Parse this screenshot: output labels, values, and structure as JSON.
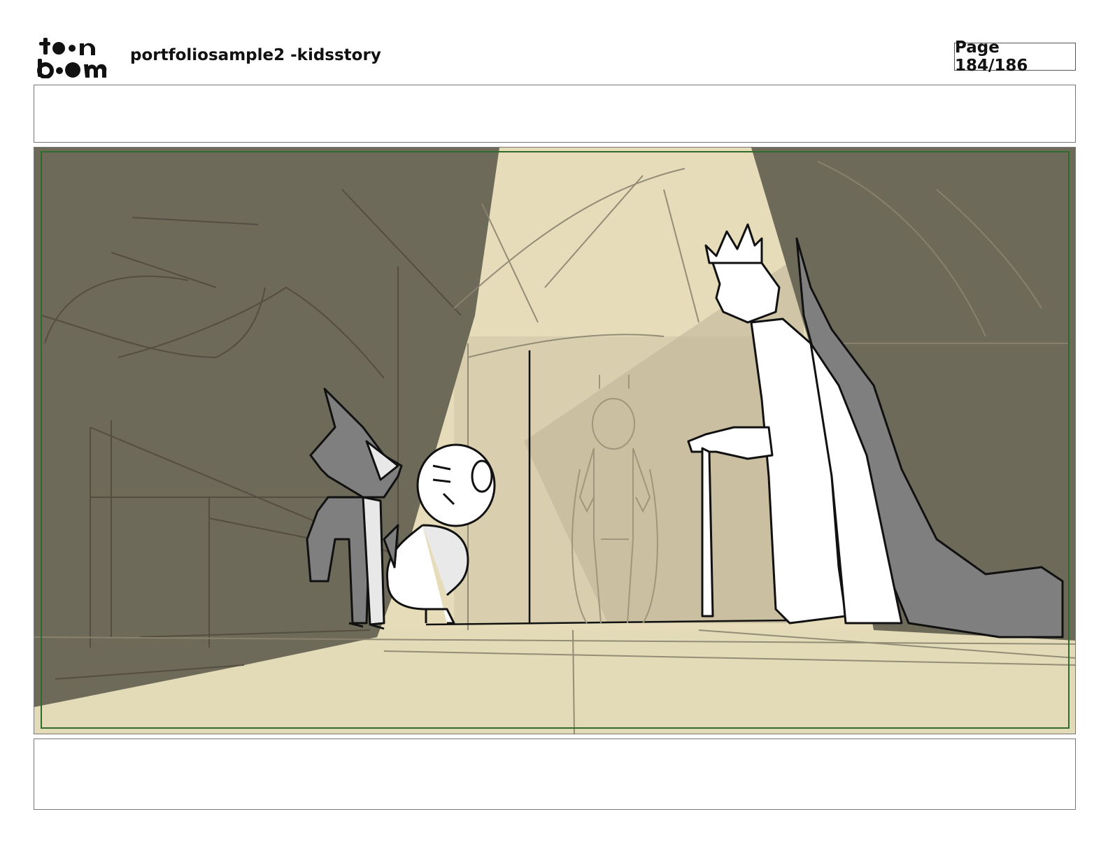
{
  "header": {
    "logo_text": "toonboom",
    "document_title": "portfoliosample2 -kidsstory",
    "page_indicator": "Page 184/186"
  },
  "panel": {
    "scene": "storyboard-sketch",
    "colors": {
      "shadow": "#6e6a5a",
      "light": "#e6dcb9",
      "floor": "#e3dab7",
      "character_gray": "#7f7f7f",
      "safe_frame": "#2f6b2a"
    }
  }
}
